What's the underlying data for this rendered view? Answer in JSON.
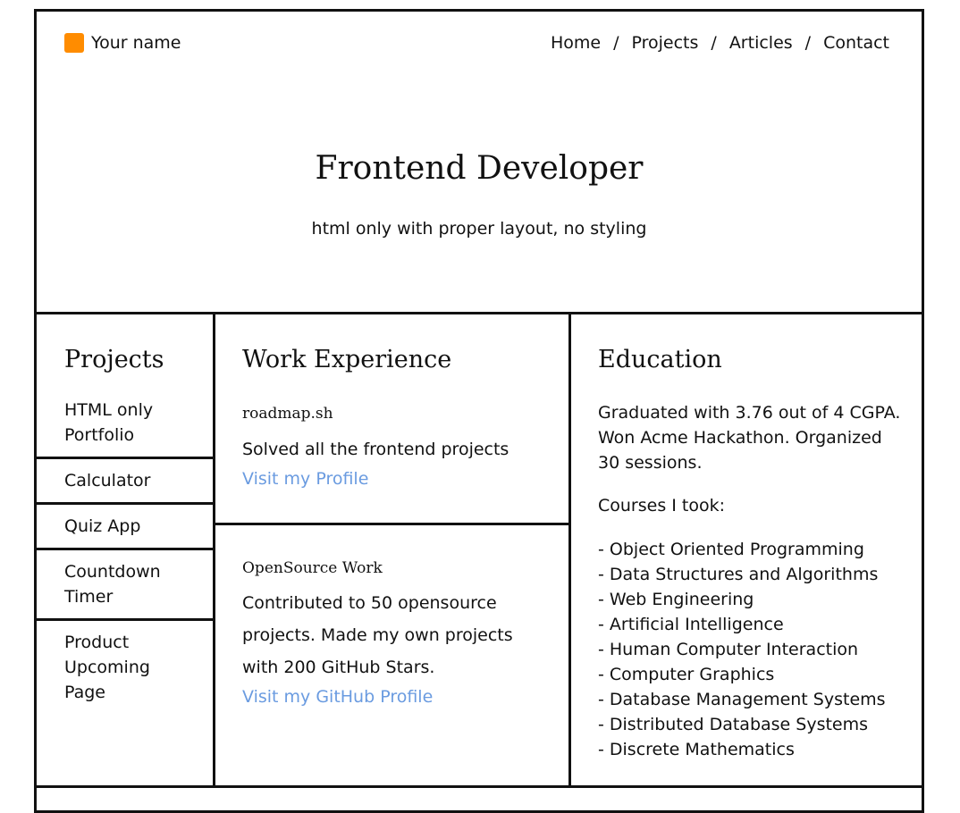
{
  "header": {
    "logo_text": "Your name",
    "logo_color": "#ff8c00",
    "nav": [
      {
        "label": "Home"
      },
      {
        "label": "Projects"
      },
      {
        "label": "Articles"
      },
      {
        "label": "Contact"
      }
    ],
    "separator": "/"
  },
  "hero": {
    "title": "Frontend Developer",
    "subtitle": "html only with proper layout, no styling"
  },
  "projects": {
    "title": "Projects",
    "items": [
      "HTML only Portfolio",
      "Calculator",
      "Quiz App",
      "Countdown Timer",
      "Product Upcoming Page"
    ]
  },
  "work": {
    "title": "Work Experience",
    "entries": [
      {
        "company": "roadmap.sh",
        "description": "Solved all the frontend projects",
        "link": "Visit my Profile"
      },
      {
        "company": "OpenSource Work",
        "description": "Contributed to 50 opensource projects. Made my own projects with 200 GitHub Stars.",
        "link": "Visit my GitHub Profile"
      }
    ]
  },
  "education": {
    "title": "Education",
    "summary": "Graduated with 3.76 out of 4 CGPA. Won Acme Hackathon. Organized 30 sessions.",
    "courses_label": "Courses I took:",
    "courses": [
      "- Object Oriented Programming",
      "- Data Structures and Algorithms",
      "- Web Engineering",
      "- Artificial Intelligence",
      "- Human Computer Interaction",
      "- Computer Graphics",
      "- Database Management Systems",
      "- Distributed Database Systems",
      "- Discrete Mathematics"
    ]
  },
  "colors": {
    "link": "#6a9be0",
    "border": "#111111"
  }
}
